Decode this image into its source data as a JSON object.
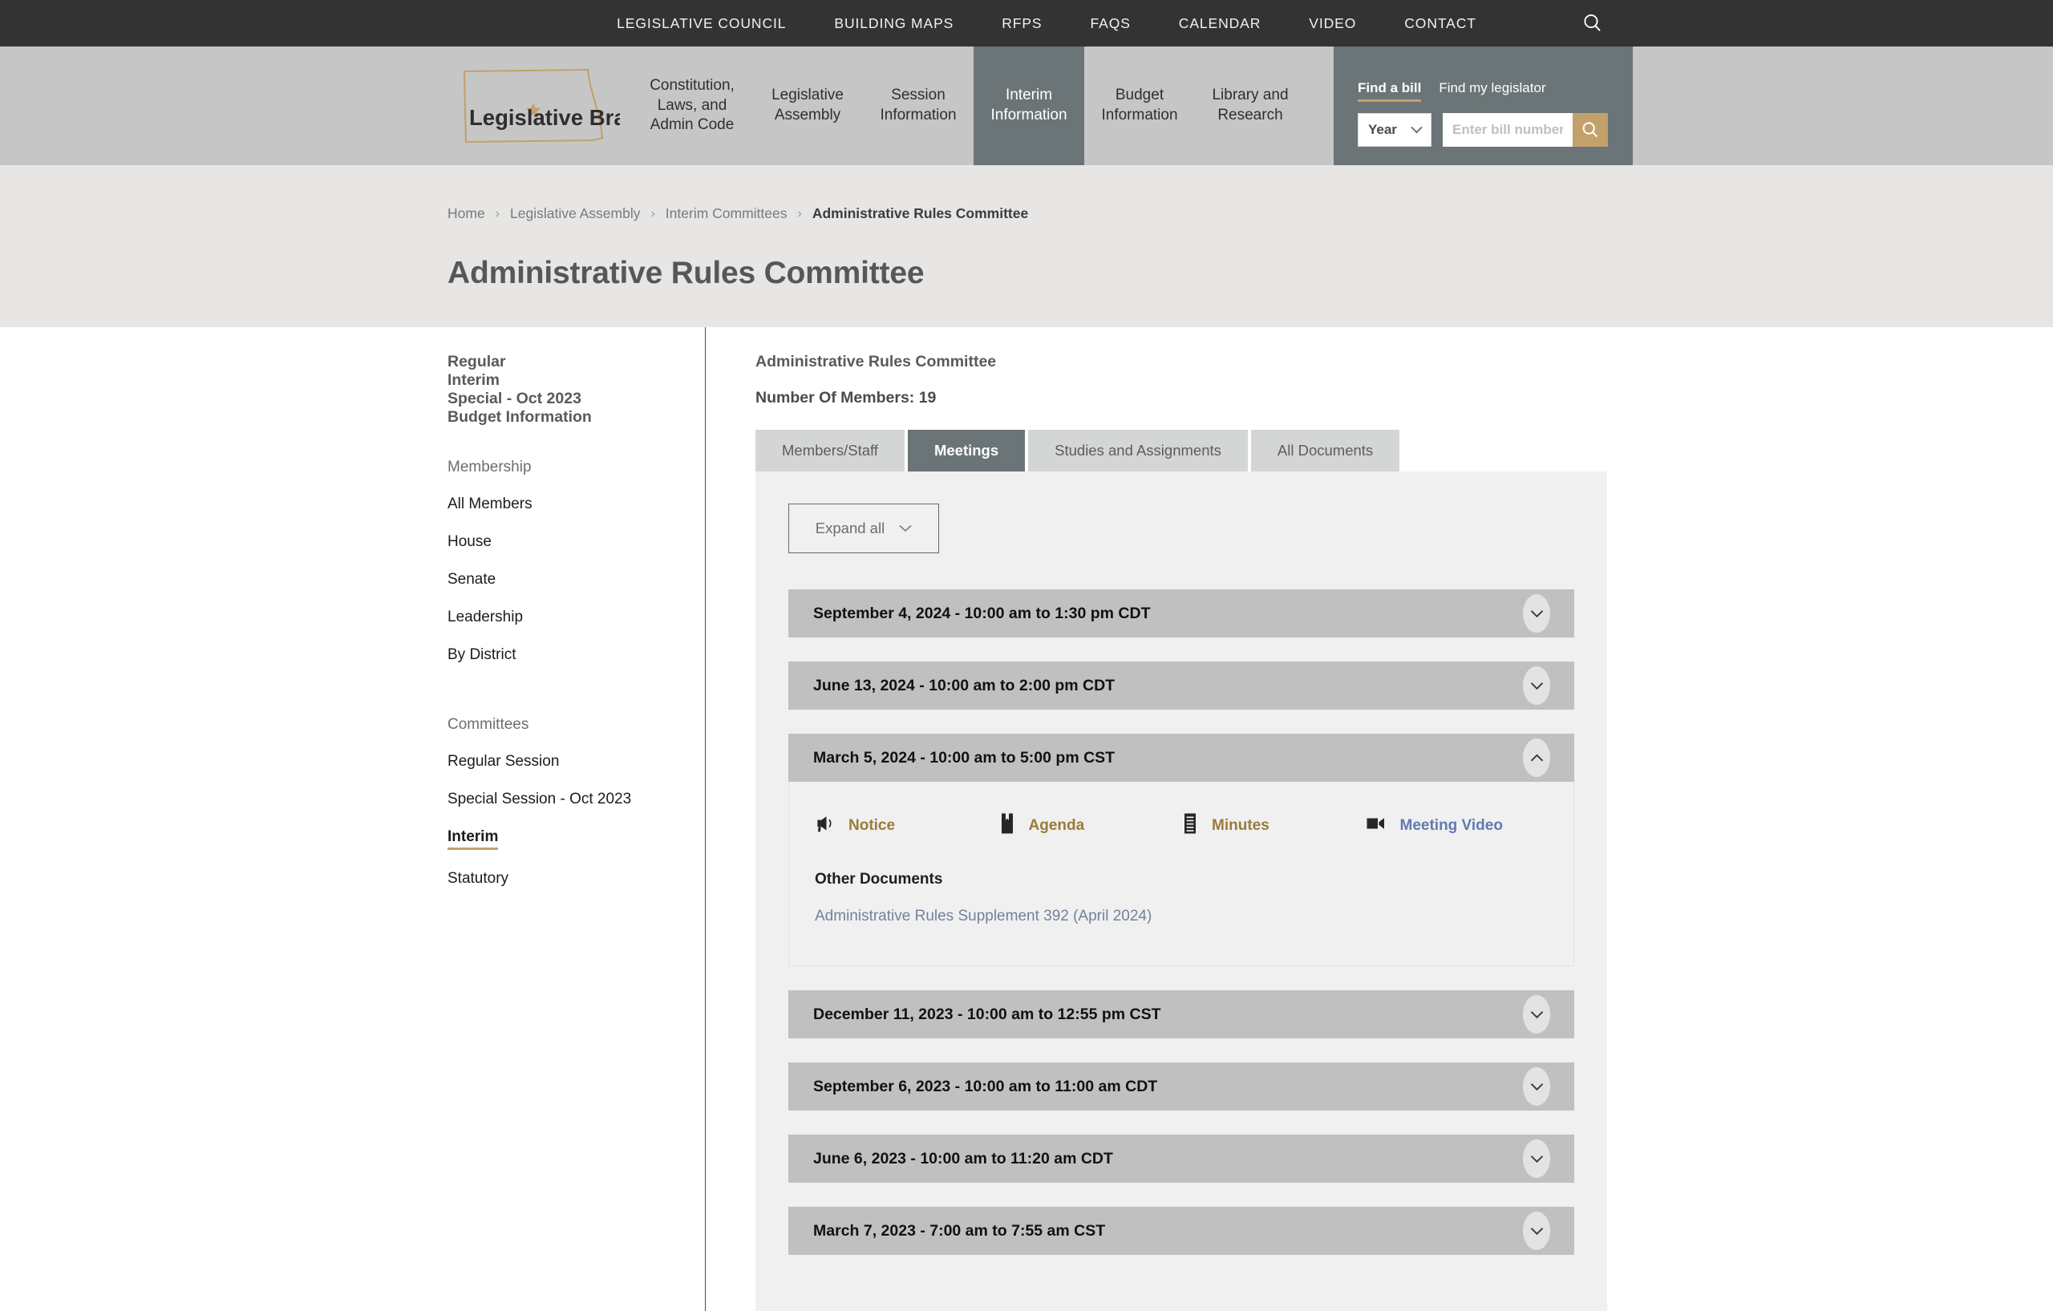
{
  "colors": {
    "topbar_bg": "#333333",
    "header_bg": "#c6c6c6",
    "accent_slate": "#6b7476",
    "accent_gold": "#c2a16b",
    "crumb_band_bg": "#e7e6e4",
    "panel_bg": "#f0f0f0",
    "accordion_head_bg": "#c0c0c0",
    "doc_link_gold": "#9c7b38",
    "video_link_blue": "#5f7ab4",
    "other_link_blue": "#74819c"
  },
  "topbar": {
    "links": [
      {
        "label": "LEGISLATIVE COUNCIL"
      },
      {
        "label": "BUILDING MAPS"
      },
      {
        "label": "RFPS"
      },
      {
        "label": "FAQS"
      },
      {
        "label": "CALENDAR"
      },
      {
        "label": "VIDEO"
      },
      {
        "label": "CONTACT"
      }
    ],
    "search_icon": "search-icon"
  },
  "logo": {
    "text": "Legislative Branch",
    "shape": "north-dakota-state-outline",
    "star": "star-marker"
  },
  "mainnav": {
    "items": [
      {
        "label": "Constitution, Laws, and Admin Code",
        "active": false,
        "wide": true
      },
      {
        "label": "Legislative Assembly",
        "active": false,
        "wide": false
      },
      {
        "label": "Session Information",
        "active": false,
        "wide": false
      },
      {
        "label": "Interim Information",
        "active": true,
        "wide": false
      },
      {
        "label": "Budget Information",
        "active": false,
        "wide": false
      },
      {
        "label": "Library and Research",
        "active": false,
        "wide": false
      }
    ]
  },
  "findbill": {
    "tab_bill": "Find a bill",
    "tab_legislator": "Find my legislator",
    "year_select_value": "Year",
    "bill_placeholder": "Enter bill number",
    "bill_value": "",
    "search_icon": "search-icon",
    "chevron_icon": "chevron-down-icon"
  },
  "breadcrumb": {
    "items": [
      {
        "label": "Home",
        "current": false
      },
      {
        "label": "Legislative Assembly",
        "current": false
      },
      {
        "label": "Interim Committees",
        "current": false
      },
      {
        "label": "Administrative Rules Committee",
        "current": true
      }
    ],
    "separator": "›"
  },
  "page": {
    "title": "Administrative Rules Committee"
  },
  "sidebar": {
    "strong_items": [
      {
        "label": "Regular"
      },
      {
        "label": "Interim"
      },
      {
        "label": "Special - Oct 2023"
      },
      {
        "label": "Budget Information"
      }
    ],
    "membership_head": "Membership",
    "membership_items": [
      {
        "label": "All Members",
        "active": false
      },
      {
        "label": "House",
        "active": false
      },
      {
        "label": "Senate",
        "active": false
      },
      {
        "label": "Leadership",
        "active": false
      },
      {
        "label": "By District",
        "active": false
      }
    ],
    "committees_head": "Committees",
    "committees_items": [
      {
        "label": "Regular Session",
        "active": false
      },
      {
        "label": "Special Session - Oct 2023",
        "active": false
      },
      {
        "label": "Interim",
        "active": true
      },
      {
        "label": "Statutory",
        "active": false
      }
    ]
  },
  "main": {
    "committee_name": "Administrative Rules Committee",
    "member_count_label": "Number Of Members: 19",
    "tabs": [
      {
        "label": "Members/Staff",
        "active": false
      },
      {
        "label": "Meetings",
        "active": true
      },
      {
        "label": "Studies and Assignments",
        "active": false
      },
      {
        "label": "All Documents",
        "active": false
      }
    ],
    "expand_all_label": "Expand all",
    "expand_all_icon": "chevron-down-icon",
    "meetings": [
      {
        "title": "September 4, 2024 - 10:00 am to 1:30 pm CDT",
        "expanded": false,
        "toggle_icon": "chevron-down-icon"
      },
      {
        "title": "June 13, 2024 - 10:00 am to 2:00 pm CDT",
        "expanded": false,
        "toggle_icon": "chevron-down-icon"
      },
      {
        "title": "March 5, 2024 - 10:00 am to 5:00 pm CST",
        "expanded": true,
        "toggle_icon": "chevron-up-icon",
        "documents": [
          {
            "label": "Notice",
            "icon": "megaphone-icon",
            "style": "gold"
          },
          {
            "label": "Agenda",
            "icon": "bookmark-document-icon",
            "style": "gold"
          },
          {
            "label": "Minutes",
            "icon": "lined-document-icon",
            "style": "gold"
          },
          {
            "label": "Meeting Video",
            "icon": "video-camera-icon",
            "style": "video"
          }
        ],
        "other_documents_head": "Other Documents",
        "other_documents": [
          {
            "label": "Administrative Rules Supplement 392 (April 2024)"
          }
        ]
      },
      {
        "title": "December 11, 2023 - 10:00 am to 12:55 pm CST",
        "expanded": false,
        "toggle_icon": "chevron-down-icon"
      },
      {
        "title": "September 6, 2023 - 10:00 am to 11:00 am CDT",
        "expanded": false,
        "toggle_icon": "chevron-down-icon"
      },
      {
        "title": "June 6, 2023 - 10:00 am to 11:20 am CDT",
        "expanded": false,
        "toggle_icon": "chevron-down-icon"
      },
      {
        "title": "March 7, 2023 - 7:00 am to 7:55 am CST",
        "expanded": false,
        "toggle_icon": "chevron-down-icon"
      }
    ]
  }
}
